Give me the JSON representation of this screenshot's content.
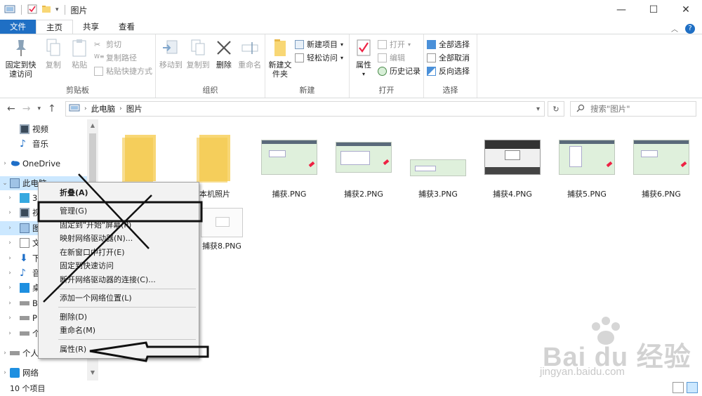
{
  "window": {
    "title": "图片",
    "controls": [
      "—",
      "☐",
      "✕"
    ]
  },
  "tabs": [
    "文件",
    "主页",
    "共享",
    "查看"
  ],
  "ribbon": {
    "clipboard": {
      "label": "剪贴板",
      "pin": "固定到快速访问",
      "copy": "复制",
      "paste": "粘贴",
      "cut": "剪切",
      "copy_path": "复制路径",
      "paste_shortcut": "粘贴快捷方式"
    },
    "organize": {
      "label": "组织",
      "move_to": "移动到",
      "copy_to": "复制到",
      "delete": "删除",
      "rename": "重命名"
    },
    "new": {
      "label": "新建",
      "new_folder": "新建文件夹",
      "new_item": "新建项目",
      "easy_access": "轻松访问"
    },
    "open": {
      "label": "打开",
      "properties": "属性",
      "open": "打开",
      "edit": "编辑",
      "history": "历史记录"
    },
    "select": {
      "label": "选择",
      "select_all": "全部选择",
      "select_none": "全部取消",
      "invert": "反向选择"
    }
  },
  "address": {
    "crumbs": [
      "此电脑",
      "图片"
    ],
    "search_placeholder": "搜索\"图片\""
  },
  "nav_pane": {
    "items": [
      {
        "label": "视频",
        "indent": 2
      },
      {
        "label": "音乐",
        "indent": 2
      },
      {
        "label": "OneDrive",
        "indent": 1
      },
      {
        "label": "此电脑",
        "indent": 1
      },
      {
        "label": "3",
        "indent": 2
      },
      {
        "label": "视",
        "indent": 2
      },
      {
        "label": "图",
        "indent": 2
      },
      {
        "label": "文",
        "indent": 2
      },
      {
        "label": "下",
        "indent": 2
      },
      {
        "label": "音",
        "indent": 2
      },
      {
        "label": "桌",
        "indent": 2
      },
      {
        "label": "BO",
        "indent": 2
      },
      {
        "label": "PI",
        "indent": 2
      },
      {
        "label": "个",
        "indent": 2
      },
      {
        "label": "个人",
        "indent": 1
      },
      {
        "label": "网络",
        "indent": 1
      }
    ]
  },
  "files": [
    {
      "name": "",
      "kind": "folder"
    },
    {
      "name": "本机照片",
      "kind": "folder"
    },
    {
      "name": "捕获.PNG",
      "kind": "image"
    },
    {
      "name": "捕获2.PNG",
      "kind": "image"
    },
    {
      "name": "捕获3.PNG",
      "kind": "image"
    },
    {
      "name": "捕获4.PNG",
      "kind": "image"
    },
    {
      "name": "捕获5.PNG",
      "kind": "image"
    },
    {
      "name": "捕获6.PNG",
      "kind": "image"
    },
    {
      "name": "捕获8.PNG",
      "kind": "image"
    }
  ],
  "context_menu": {
    "items": [
      {
        "label": "折叠(A)",
        "bold": true
      },
      {
        "sep": true
      },
      {
        "label": "管理(G)"
      },
      {
        "label": "固定到\"开始\"屏幕(P)"
      },
      {
        "label": "映射网络驱动器(N)..."
      },
      {
        "label": "在新窗口中打开(E)"
      },
      {
        "label": "固定到快速访问"
      },
      {
        "label": "断开网络驱动器的连接(C)..."
      },
      {
        "sep": true
      },
      {
        "label": "添加一个网络位置(L)"
      },
      {
        "sep": true
      },
      {
        "label": "删除(D)"
      },
      {
        "label": "重命名(M)"
      },
      {
        "sep": true
      },
      {
        "label": "属性(R)"
      }
    ]
  },
  "status": {
    "count": "10 个项目"
  },
  "watermark": {
    "brand": "Bai du 经验",
    "url": "jingyan.baidu.com"
  },
  "colors": {
    "file_tab": "#1f6fc4",
    "selection": "#cce8ff",
    "folder": "#f8d775"
  }
}
